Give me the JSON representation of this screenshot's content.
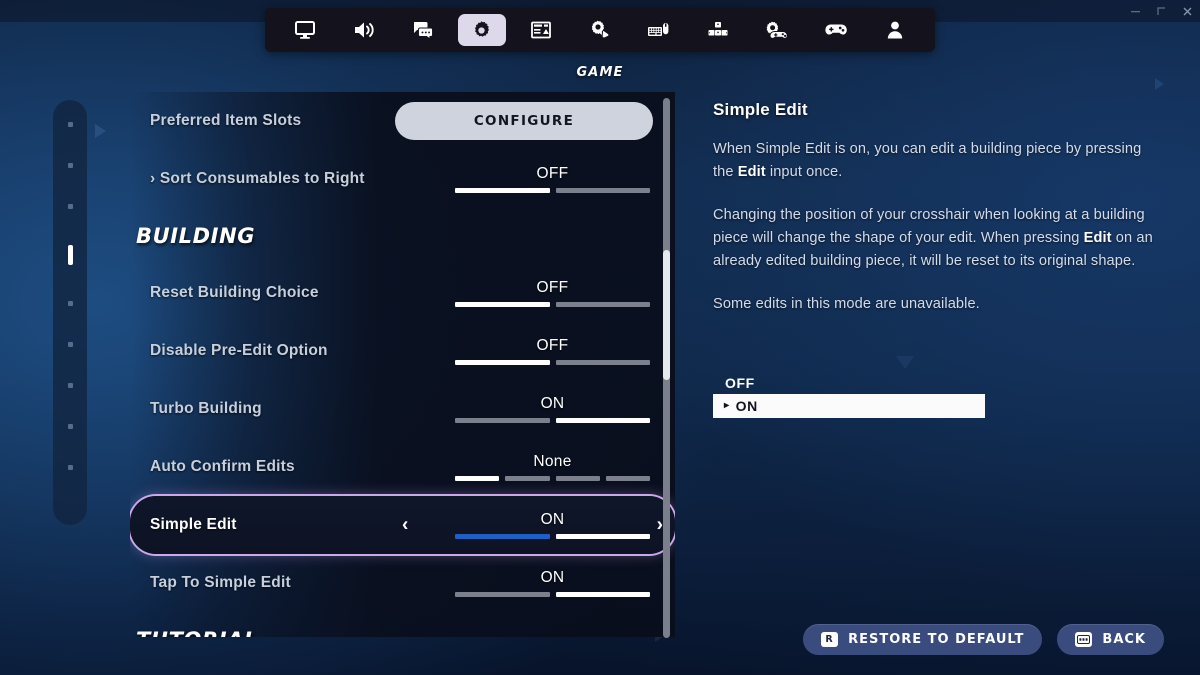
{
  "window": {
    "minimize_label": "minimize",
    "maximize_label": "maximize",
    "close_label": "close"
  },
  "tabbar": {
    "active_label": "GAME",
    "tabs": [
      {
        "icon": "monitor-icon",
        "name": "video"
      },
      {
        "icon": "speaker-icon",
        "name": "audio"
      },
      {
        "icon": "chat-bubbles-icon",
        "name": "social"
      },
      {
        "icon": "gear-icon",
        "name": "game",
        "active": true
      },
      {
        "icon": "hud-layout-icon",
        "name": "hud"
      },
      {
        "icon": "touch-settings-icon",
        "name": "input"
      },
      {
        "icon": "keyboard-mouse-icon",
        "name": "keyboard-mouse"
      },
      {
        "icon": "building-blocks-icon",
        "name": "builder"
      },
      {
        "icon": "controller-gear-icon",
        "name": "controller-config"
      },
      {
        "icon": "gamepad-icon",
        "name": "controller"
      },
      {
        "icon": "account-icon",
        "name": "account"
      }
    ]
  },
  "rail": {
    "dots": [
      {
        "active": false
      },
      {
        "active": false
      },
      {
        "active": false
      },
      {
        "active": true
      },
      {
        "active": false
      },
      {
        "active": false
      },
      {
        "active": false
      },
      {
        "active": false
      },
      {
        "active": false
      }
    ]
  },
  "settings": {
    "rows": [
      {
        "type": "button",
        "label": "Preferred Item Slots",
        "button_label": "CONFIGURE"
      },
      {
        "type": "toggle",
        "label": "› Sort Consumables to Right",
        "value": "OFF",
        "segments": [
          "on",
          "off"
        ]
      },
      {
        "type": "header",
        "label": "BUILDING"
      },
      {
        "type": "toggle",
        "label": "Reset Building Choice",
        "value": "OFF",
        "segments": [
          "on",
          "off"
        ]
      },
      {
        "type": "toggle",
        "label": "Disable Pre-Edit Option",
        "value": "OFF",
        "segments": [
          "on",
          "off"
        ]
      },
      {
        "type": "toggle",
        "label": "Turbo Building",
        "value": "ON",
        "segments": [
          "off",
          "on"
        ]
      },
      {
        "type": "toggle",
        "label": "Auto Confirm Edits",
        "value": "None",
        "segments": [
          "on",
          "off",
          "off",
          "off"
        ]
      },
      {
        "type": "toggle",
        "label": "Simple Edit",
        "value": "ON",
        "segments": [
          "blue",
          "on"
        ],
        "selected": true,
        "arrow_left": "‹",
        "arrow_right": "›"
      },
      {
        "type": "toggle",
        "label": "Tap To Simple Edit",
        "value": "ON",
        "segments": [
          "off",
          "on"
        ]
      },
      {
        "type": "header",
        "label": "TUTORIAL"
      }
    ]
  },
  "info": {
    "title": "Simple Edit",
    "paragraphs": [
      {
        "parts": [
          {
            "text": "When Simple Edit is on, you can edit a building piece by pressing the "
          },
          {
            "text": "Edit",
            "bold": true
          },
          {
            "text": " input once."
          }
        ]
      },
      {
        "parts": [
          {
            "text": "Changing the position of your crosshair when looking at a building piece will change the shape of your edit. When pressing "
          },
          {
            "text": "Edit",
            "bold": true
          },
          {
            "text": " on an already edited building piece, it will be reset to its original shape."
          }
        ]
      },
      {
        "parts": [
          {
            "text": "Some edits in this mode are unavailable."
          }
        ]
      }
    ],
    "options": [
      {
        "label": "OFF",
        "selected": false
      },
      {
        "label": "ON",
        "selected": true,
        "caret": "▸"
      }
    ]
  },
  "footer": {
    "buttons": [
      {
        "label": "RESTORE TO DEFAULT",
        "key": "R",
        "icon": "r-key-icon"
      },
      {
        "label": "BACK",
        "key": "ESC",
        "icon": "esc-key-icon"
      }
    ]
  },
  "colors": {
    "accent_selected_border": "#c9a9e8",
    "accent_blue_segment": "#1e5fc4",
    "tab_active_pill": "#ddd9ea",
    "footer_button": "#3a4c7e",
    "configure_button": "#cfd3dd"
  }
}
